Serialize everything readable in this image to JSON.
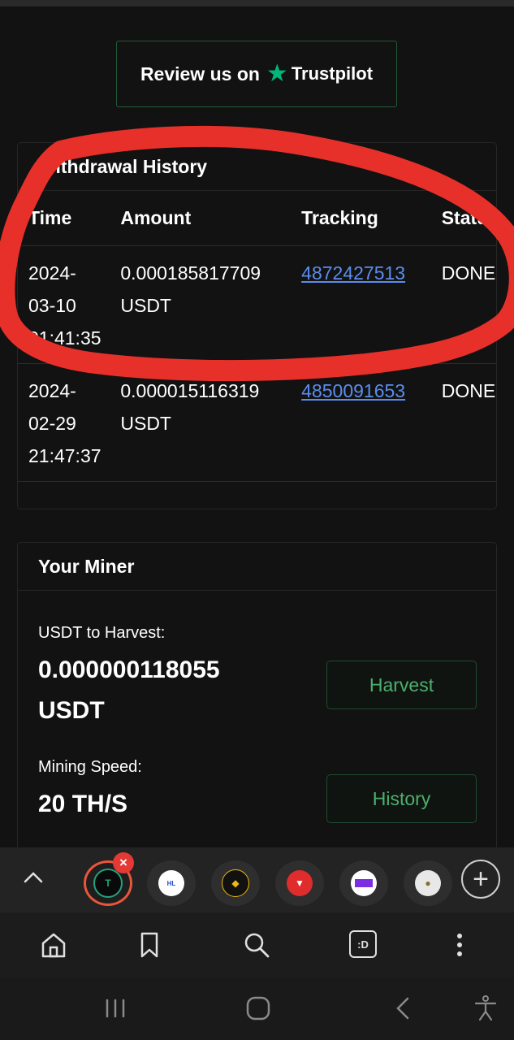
{
  "trustpilot": {
    "review_text": "Review us on",
    "brand": "Trustpilot",
    "star": "★",
    "brand_color": "#00b67a"
  },
  "withdrawal_history": {
    "title": "Withdrawal History",
    "columns": [
      "Time",
      "Amount",
      "Tracking",
      "Status"
    ],
    "rows": [
      {
        "time": "2024-\n03-10\n01:41:35",
        "amount": "0.000185817709\nUSDT",
        "tracking": "4872427513",
        "status": "DONE"
      },
      {
        "time": "2024-\n02-29\n21:47:37",
        "amount": "0.000015116319\nUSDT",
        "tracking": "4850091653",
        "status": "DONE"
      }
    ]
  },
  "miner": {
    "title": "Your Miner",
    "harvest_label": "USDT to Harvest:",
    "harvest_value": "0.000000118055",
    "harvest_unit": "USDT",
    "harvest_button": "Harvest",
    "speed_label": "Mining Speed:",
    "speed_value": "20 TH/S",
    "history_button": "History",
    "button_color": "#4caf6d"
  },
  "browser_tabs": {
    "icons": [
      "chevron-up-icon",
      "tab-favicon-tether",
      "tab-favicon-helmlink",
      "tab-favicon-binance",
      "tab-favicon-tron",
      "tab-favicon-purple",
      "tab-favicon-coin",
      "add-tab-icon"
    ],
    "close_badge": "×",
    "add": "+",
    "active_accent": "#e9563a"
  },
  "bottom_nav": {
    "icons": [
      "home-icon",
      "bookmark-icon",
      "search-icon",
      "tabs-icon",
      "more-icon"
    ],
    "tabs_label": ":D"
  },
  "system_nav": {
    "icons": [
      "recent-apps-icon",
      "home-circle-icon",
      "back-icon",
      "accessibility-icon"
    ]
  },
  "annotation": {
    "color": "#e8302a"
  }
}
